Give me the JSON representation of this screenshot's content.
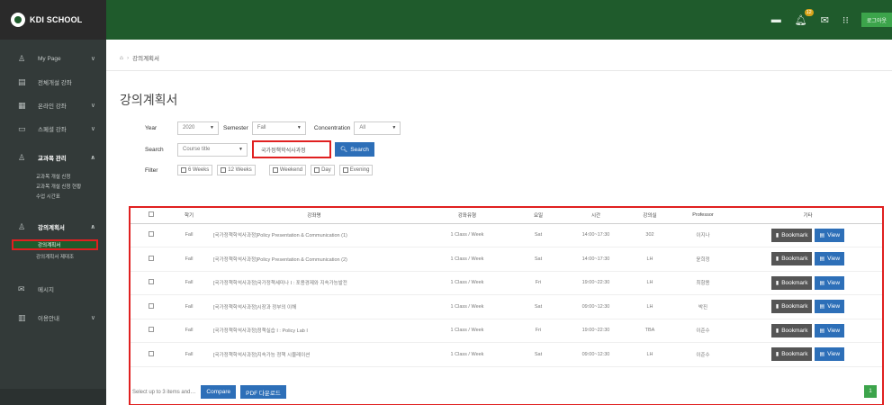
{
  "header": {
    "logo_text": "KDI SCHOOL",
    "notification_count": "12",
    "login_label": "로그아웃"
  },
  "sidebar": {
    "items": [
      {
        "label": "My Page",
        "icon": "user-icon",
        "chevron": "∨"
      },
      {
        "label": "전체개설 강좌",
        "icon": "book-icon",
        "chevron": ""
      },
      {
        "label": "온라인 강좌",
        "icon": "grid-icon",
        "chevron": "∨"
      },
      {
        "label": "스페셜 강좌",
        "icon": "monitor-icon",
        "chevron": "∨"
      },
      {
        "label": "교과목 관리",
        "icon": "user-icon",
        "chevron": "∧"
      }
    ],
    "sub_course": [
      "교과목 개설 신청",
      "교과목 개설 신청 현황",
      "수업 시간표"
    ],
    "syllabus": {
      "label": "강의계획서",
      "icon": "user-icon",
      "chevron": "∧"
    },
    "sub_syllabus": [
      "강의계획서",
      "강의계획서 제대조"
    ],
    "bottom_items": [
      {
        "label": "메시지",
        "icon": "mail-icon",
        "chevron": ""
      },
      {
        "label": "이용안내",
        "icon": "book-icon",
        "chevron": "∨"
      }
    ]
  },
  "breadcrumb": {
    "home": "⌂",
    "current": "강의계획서"
  },
  "page_title": "강의계획서",
  "filters": {
    "year_label": "Year",
    "year_value": "2020",
    "semester_label": "Semester",
    "semester_value": "Fall",
    "concentration_label": "Concentration",
    "concentration_value": "All",
    "search_label": "Search",
    "search_field": "Course title",
    "search_value": "국가정책학석사과정",
    "search_button": "Search",
    "filter_label": "Filter",
    "checkboxes": [
      "6 Weeks",
      "12 Weeks",
      "Weekend",
      "Day",
      "Evening"
    ]
  },
  "table": {
    "headers": [
      "",
      "학기",
      "강좌명",
      "강좌유형",
      "요일",
      "시간",
      "강의실",
      "Professor",
      "기타"
    ],
    "rows": [
      {
        "term": "Fall",
        "course": "[국가정책학석사과정]Policy Presentation & Communication (1)",
        "type": "1 Class / Week",
        "day": "Sat",
        "time": "14:00~17:30",
        "room": "302",
        "prof": "이지나"
      },
      {
        "term": "Fall",
        "course": "[국가정책학석사과정]Policy Presentation & Communication (2)",
        "type": "1 Class / Week",
        "day": "Sat",
        "time": "14:00~17:30",
        "room": "LH",
        "prof": "윤희정"
      },
      {
        "term": "Fall",
        "course": "[국가정책학석사과정]국가정책세미나 I : 포용경제와 지속가능발전",
        "type": "1 Class / Week",
        "day": "Fri",
        "time": "19:00~22:30",
        "room": "LH",
        "prof": "최항용"
      },
      {
        "term": "Fall",
        "course": "[국가정책학석사과정]시장과 정부의 이해",
        "type": "1 Class / Week",
        "day": "Sat",
        "time": "09:00~12:30",
        "room": "LH",
        "prof": "박진"
      },
      {
        "term": "Fall",
        "course": "[국가정책학석사과정]정책실습 I : Policy Lab I",
        "type": "1 Class / Week",
        "day": "Fri",
        "time": "19:00~22:30",
        "room": "TBA",
        "prof": "이준수"
      },
      {
        "term": "Fall",
        "course": "[국가정책학석사과정]지속가능 정책 시뮬레이션",
        "type": "1 Class / Week",
        "day": "Sat",
        "time": "09:00~12:30",
        "room": "LH",
        "prof": "이준수"
      }
    ],
    "bookmark_label": "Bookmark",
    "view_label": "View"
  },
  "footer": {
    "select_text": "Select up to 3 items and…",
    "compare_label": "Compare",
    "pdf_label": "PDF 다운로드",
    "page": "1"
  }
}
